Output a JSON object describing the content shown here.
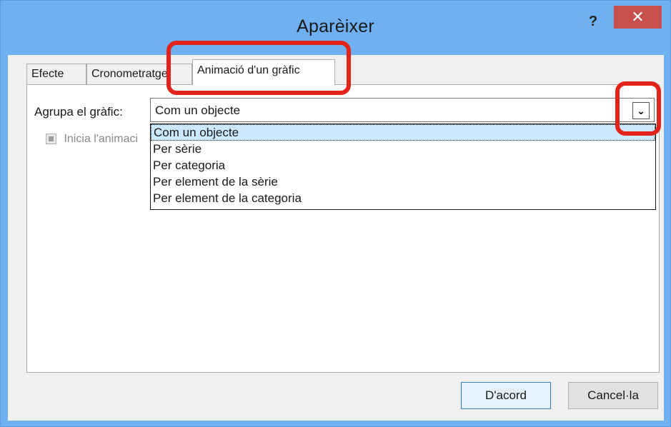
{
  "window": {
    "title": "Aparèixer",
    "help_label": "?",
    "close_label": "✕"
  },
  "tabs": [
    {
      "label": "Efecte",
      "active": false
    },
    {
      "label": "Cronometratge",
      "active": false
    },
    {
      "label": "Animació d'un gràfic",
      "active": true
    }
  ],
  "panel": {
    "group_label": "Agrupa el gràfic:",
    "group_value": "Com un objecte",
    "dropdown_arrow_icon": "chevron-down-icon",
    "checkbox_label": "Inicia l'animació dibuixant el fons del gràfic",
    "checkbox_visible_label": "Inicia l'animaci",
    "options": [
      "Com un objecte",
      "Per sèrie",
      "Per categoria",
      "Per element de la sèrie",
      "Per element de la categoria"
    ],
    "selected_option_index": 0
  },
  "buttons": {
    "ok_label": "D'acord",
    "cancel_label": "Cancel·la"
  },
  "colors": {
    "titlebar": "#6fb0f0",
    "close": "#c7504c",
    "highlight": "#e3231a",
    "selection": "#cce8ff"
  }
}
